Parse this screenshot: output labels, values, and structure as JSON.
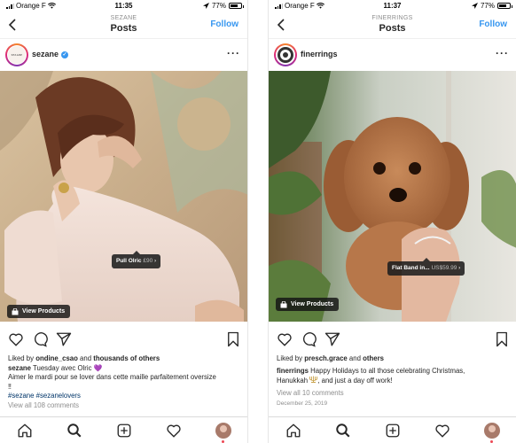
{
  "colors": {
    "accent": "#3897f0",
    "text": "#262626",
    "muted": "#8e8e8e",
    "hashtag": "#003569",
    "notification": "#ed4956"
  },
  "left": {
    "status": {
      "carrier": "Orange F",
      "time": "11:35",
      "battery": "77%",
      "battery_level": 0.77
    },
    "nav": {
      "subtitle": "SEZANE",
      "title": "Posts",
      "follow": "Follow"
    },
    "post": {
      "username": "sezane",
      "avatar_text": "SEZANE",
      "verified": true,
      "tag": {
        "name": "Pull Olric",
        "price": "£90"
      },
      "view_products": "View Products",
      "liked_by_prefix": "Liked by ",
      "liked_by_user": "ondine_csao",
      "liked_by_and": " and ",
      "liked_by_rest": "thousands of others",
      "caption_user": "sezane",
      "caption_line1": " Tuesday avec Olric 💜",
      "caption_line2": "Aimer le mardi pour se lover dans cette maille parfaitement oversize",
      "caption_line3": "‼",
      "hashtags": "#sezane #sezanelovers",
      "comments": "View all 108 comments"
    }
  },
  "right": {
    "status": {
      "carrier": "Orange F",
      "time": "11:37",
      "battery": "77%",
      "battery_level": 0.77
    },
    "nav": {
      "subtitle": "FINERRINGS",
      "title": "Posts",
      "follow": "Follow"
    },
    "post": {
      "username": "finerrings",
      "tag": {
        "name": "Flat Band in...",
        "price": "US$59.99"
      },
      "view_products": "View Products",
      "liked_by_prefix": "Liked by ",
      "liked_by_user": "presch.grace",
      "liked_by_and": " and ",
      "liked_by_rest": "others",
      "caption_user": "finerrings",
      "caption_line1": " Happy Holidays to all those celebrating Christmas,",
      "caption_line2": "Hanukkah ",
      "caption_line2_rest": ", and just a day off work!",
      "comments": "View all 10 comments",
      "date": "December 25, 2019"
    }
  },
  "icons": [
    "back-chevron-icon",
    "more-options-icon",
    "heart-icon",
    "comment-icon",
    "share-icon",
    "bookmark-icon",
    "home-icon",
    "search-icon",
    "add-post-icon",
    "activity-heart-icon",
    "shopping-bag-icon",
    "verified-icon"
  ]
}
